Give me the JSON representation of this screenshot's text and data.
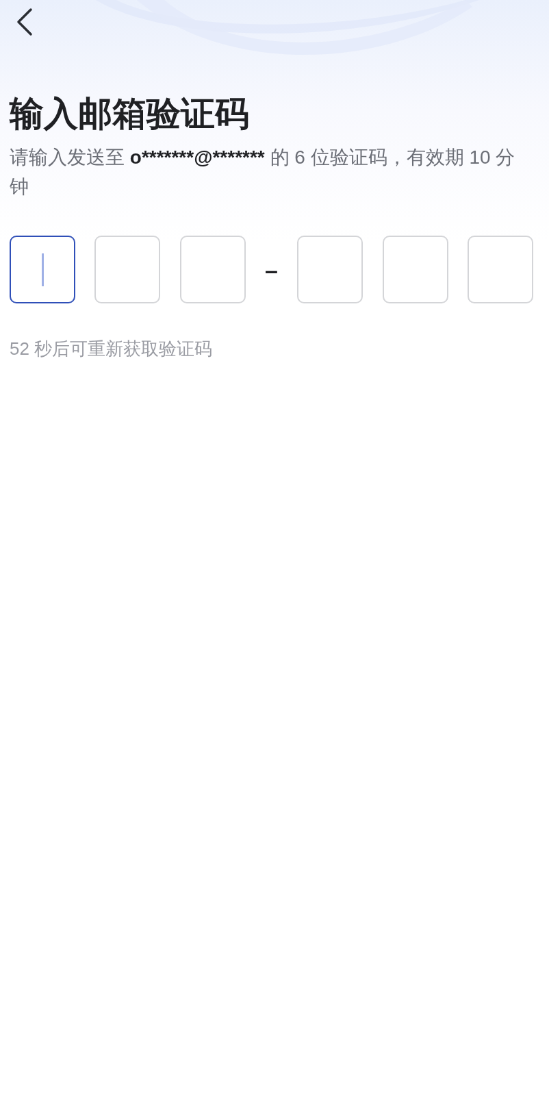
{
  "title": "输入邮箱验证码",
  "subtitle": {
    "before": "请输入发送至",
    "email": "o*******@*******",
    "after": "的 6 位验证码，有效期 10 分钟"
  },
  "code_boxes": [
    {
      "focused": true
    },
    {
      "focused": false
    },
    {
      "focused": false
    },
    {
      "focused": false
    },
    {
      "focused": false
    },
    {
      "focused": false
    }
  ],
  "separator": "–",
  "resend_hint": "52 秒后可重新获取验证码"
}
